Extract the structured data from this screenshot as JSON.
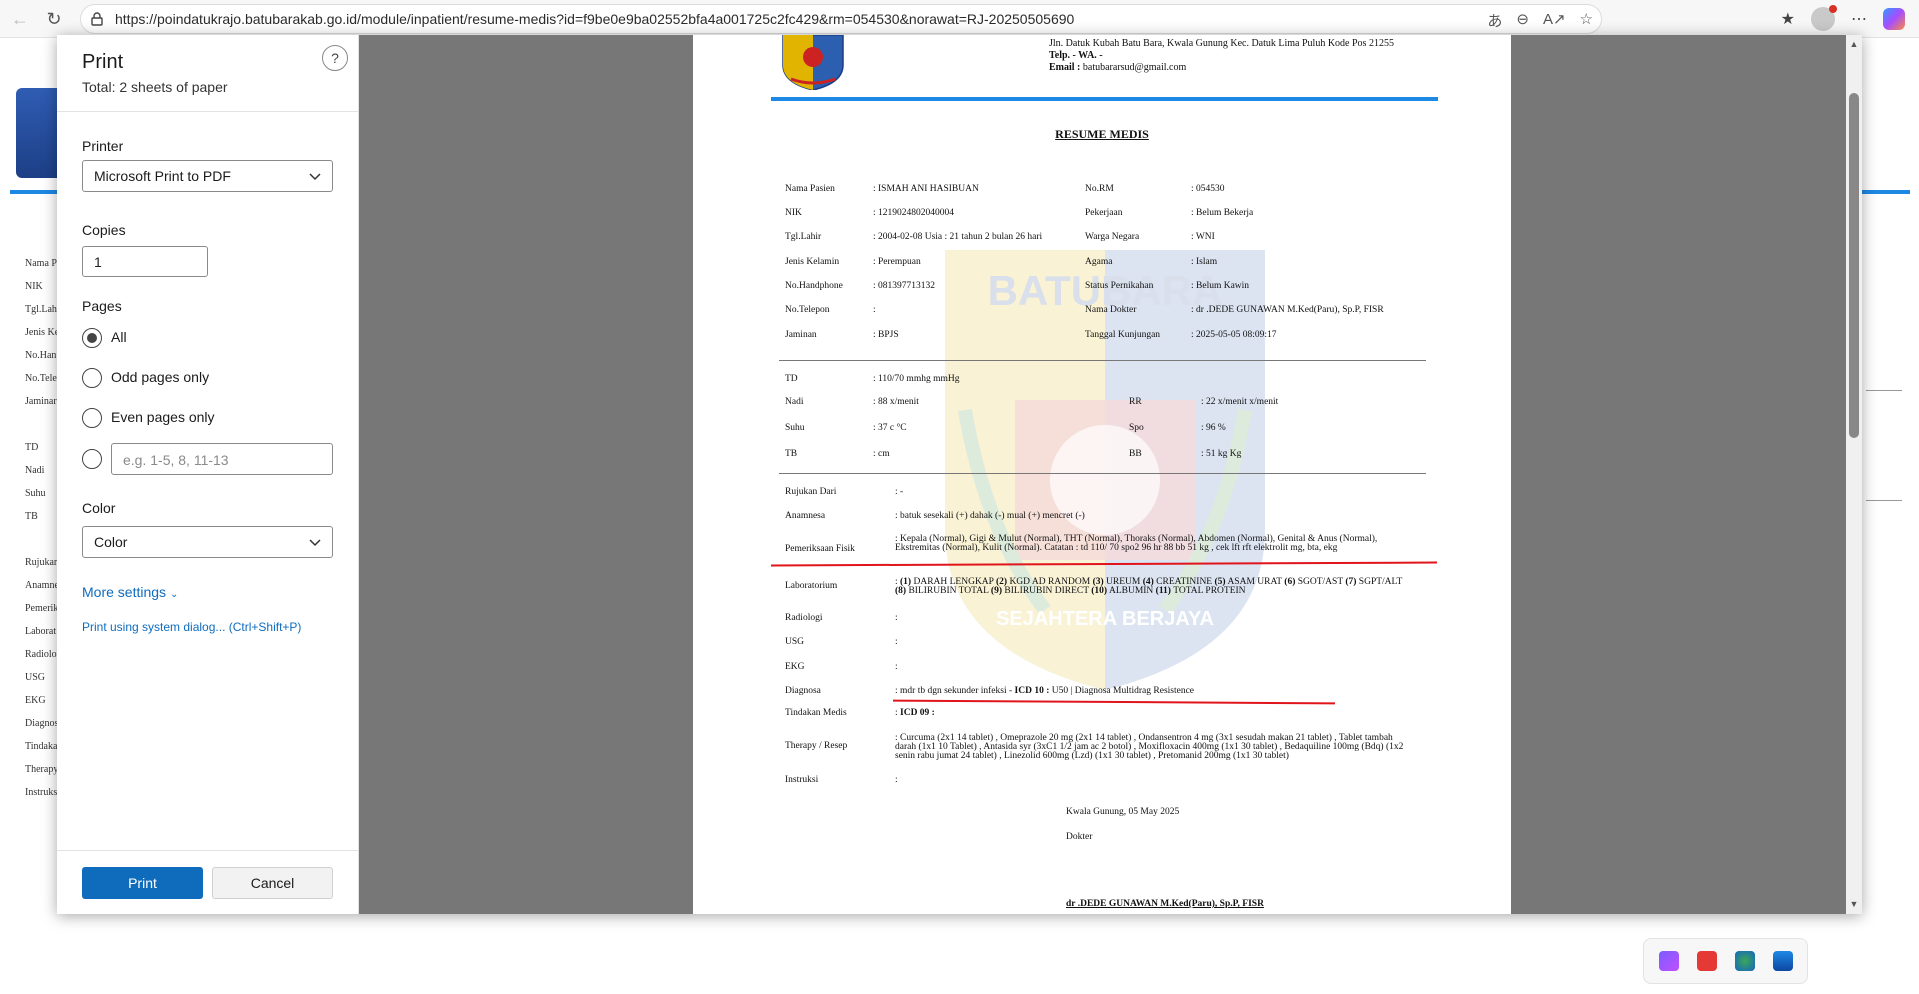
{
  "browser": {
    "url": "https://poindatukrajo.batubarakab.go.id/module/inpatient/resume-medis?id=f9be0e9ba02552bfa4a001725c2fc429&rm=054530&norawat=RJ-20250505690"
  },
  "background_labels": [
    "Nama P",
    "NIK",
    "Tgl.Lah",
    "Jenis Ke",
    "No.Han",
    "No.Tele",
    "Jaminar",
    "",
    "TD",
    "Nadi",
    "Suhu",
    "TB",
    "",
    "Rujukar",
    "Anamne",
    "Pemerik",
    "Laborat",
    "Radiolo",
    "USG",
    "EKG",
    "Diagnos",
    "Tindaka",
    "Therapy",
    "Instruks"
  ],
  "print_dialog": {
    "title": "Print",
    "subtitle": "Total: 2 sheets of paper",
    "help": "?",
    "printer_label": "Printer",
    "printer_value": "Microsoft Print to PDF",
    "copies_label": "Copies",
    "copies_value": "1",
    "pages_label": "Pages",
    "pages_options": [
      "All",
      "Odd pages only",
      "Even pages only"
    ],
    "pages_selected": "All",
    "pages_custom_placeholder": "e.g. 1-5, 8, 11-13",
    "color_label": "Color",
    "color_value": "Color",
    "more_settings": "More settings",
    "system_dialog": "Print using system dialog... (Ctrl+Shift+P)",
    "print_button": "Print",
    "cancel_button": "Cancel"
  },
  "document": {
    "address_line1": "Jln. Datuk Kubah Batu Bara, Kwala Gunung Kec. Datuk Lima Puluh Kode Pos 21255",
    "address_telp": "Telp. - WA. -",
    "address_email_label": "Email :",
    "address_email": "batubararsud@gmail.com",
    "title": "RESUME MEDIS",
    "patient_left": [
      {
        "label": "Nama Pasien",
        "value": ": ISMAH ANI HASIBUAN"
      },
      {
        "label": "NIK",
        "value": ": 1219024802040004"
      },
      {
        "label": "Tgl.Lahir",
        "value": ": 2004-02-08 Usia : 21 tahun 2 bulan 26 hari"
      },
      {
        "label": "Jenis Kelamin",
        "value": ": Perempuan"
      },
      {
        "label": "No.Handphone",
        "value": ": 081397713132"
      },
      {
        "label": "No.Telepon",
        "value": ":"
      },
      {
        "label": "Jaminan",
        "value": ": BPJS"
      }
    ],
    "patient_right": [
      {
        "label": "No.RM",
        "value": ": 054530"
      },
      {
        "label": "Pekerjaan",
        "value": ": Belum Bekerja"
      },
      {
        "label": "Warga Negara",
        "value": ": WNI"
      },
      {
        "label": "Agama",
        "value": ": Islam"
      },
      {
        "label": "Status Pernikahan",
        "value": ": Belum Kawin"
      },
      {
        "label": "Nama Dokter",
        "value": ": dr .DEDE GUNAWAN M.Ked(Paru), Sp.P, FISR"
      },
      {
        "label": "Tanggal Kunjungan",
        "value": ": 2025-05-05 08:09:17"
      }
    ],
    "vitals_td": {
      "label": "TD",
      "value": ": 110/70 mmhg mmHg"
    },
    "vitals_left": [
      {
        "label": "Nadi",
        "value": ": 88 x/menit"
      },
      {
        "label": "Suhu",
        "value": ": 37 c °C"
      },
      {
        "label": "TB",
        "value": ": cm"
      }
    ],
    "vitals_right": [
      {
        "label": "RR",
        "value": ": 22 x/menit x/menit"
      },
      {
        "label": "Spo",
        "value": ": 96 %"
      },
      {
        "label": "BB",
        "value": ": 51 kg Kg"
      }
    ],
    "rujukan": {
      "label": "Rujukan Dari",
      "value": ": -"
    },
    "anamnesa": {
      "label": "Anamnesa",
      "value": ": batuk sesekali (+) dahak (-) mual (+) mencret (-)"
    },
    "pemeriksaan": {
      "label": "Pemeriksaan Fisik",
      "value": ": Kepala (Normal), Gigi & Mulut (Normal), THT (Normal), Thoraks (Normal), Abdomen (Normal), Genital & Anus (Normal), Ekstremitas (Normal), Kulit (Normal). Catatan : td 110/ 70 spo2 96 hr 88 bb 51 kg , cek lft rft elektrolit mg, bta, ekg"
    },
    "laboratorium": {
      "label": "Laboratorium",
      "value_parts": [
        ":",
        "(1)",
        "DARAH LENGKAP",
        "(2)",
        "KGD AD RANDOM",
        "(3)",
        "UREUM",
        "(4)",
        "CREATININE",
        "(5)",
        "ASAM URAT",
        "(6)",
        "SGOT/AST",
        "(7)",
        "SGPT/ALT",
        "(8)",
        "BILIRUBIN TOTAL",
        "(9)",
        "BILIRUBIN DIRECT",
        "(10)",
        "ALBUMIN",
        "(11)",
        "TOTAL PROTEIN"
      ]
    },
    "radiologi": {
      "label": "Radiologi",
      "value": ":"
    },
    "usg": {
      "label": "USG",
      "value": ":"
    },
    "ekg": {
      "label": "EKG",
      "value": ":"
    },
    "diagnosa": {
      "label": "Diagnosa",
      "value_prefix": ": mdr tb dgn sekunder infeksi -",
      "icd_label": "ICD 10 :",
      "value_suffix": "U50 | Diagnosa Multidrag Resistence"
    },
    "tindakan": {
      "label": "Tindakan Medis",
      "value_prefix": ":",
      "icd_label": "ICD 09 :"
    },
    "therapy": {
      "label": "Therapy / Resep",
      "value": ": Curcuma (2x1 14 tablet) , Omeprazole 20 mg (2x1 14 tablet) , Ondansentron 4 mg (3x1 sesudah makan 21 tablet) , Tablet tambah darah (1x1 10 Tablet) , Antasida syr (3xC1 1/2 jam ac 2 botol) , Moxifloxacin 400mg (1x1 30 tablet) , Bedaquiline 100mg (Bdq) (1x2 senin rabu jumat 24 tablet) , Linezolid 600mg (Lzd) (1x1 30 tablet) , Pretomanid 200mg (1x1 30 tablet)"
    },
    "instruksi": {
      "label": "Instruksi",
      "value": ":"
    },
    "place_date": "Kwala Gunung, 05 May 2025",
    "role": "Dokter",
    "signature_name": "dr .DEDE GUNAWAN M.Ked(Paru), Sp.P, FISR",
    "watermark_text": "BATUBARA",
    "watermark_motto": "SEJAHTERA BERJAYA"
  },
  "colors": {
    "accent": "#0f6cbd",
    "header_rule": "#1e88e5",
    "annotation": "#e0141b"
  }
}
